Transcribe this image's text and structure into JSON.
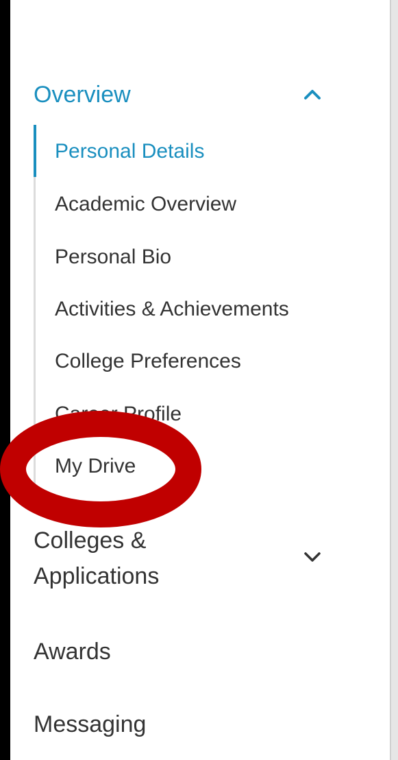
{
  "nav": {
    "sections": [
      {
        "label": "Overview",
        "expanded": true,
        "items": [
          {
            "label": "Personal Details",
            "active": true
          },
          {
            "label": "Academic Overview"
          },
          {
            "label": "Personal Bio"
          },
          {
            "label": "Activities & Achievements"
          },
          {
            "label": "College Preferences"
          },
          {
            "label": "Career Profile"
          },
          {
            "label": "My Drive"
          }
        ]
      },
      {
        "label_line1": "Colleges &",
        "label_line2": "Applications",
        "expanded": false
      },
      {
        "label": "Awards"
      },
      {
        "label": "Messaging"
      }
    ]
  },
  "colors": {
    "accent": "#1a8fbf",
    "text": "#333333",
    "annotation": "#c00000"
  },
  "icons": {
    "collapse": "chevron-up-icon",
    "expand": "chevron-down-icon"
  }
}
